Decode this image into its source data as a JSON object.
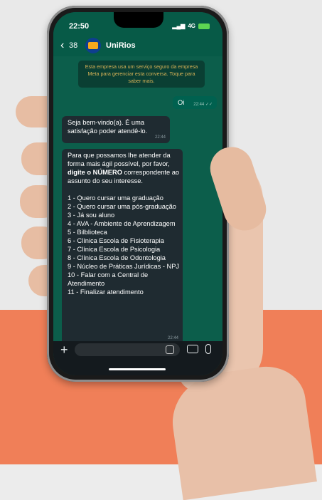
{
  "statusbar": {
    "time": "22:50",
    "network": "4G"
  },
  "header": {
    "back_count": "38",
    "contact_name": "UniRios"
  },
  "chat": {
    "system_notice": "Esta empresa usa um serviço seguro da empresa Meta para gerenciar esta conversa. Toque para saber mais.",
    "messages": [
      {
        "direction": "out",
        "text": "Oi",
        "time": "22:44"
      },
      {
        "direction": "in",
        "text": "Seja bem-vindo(a). É uma satisfação poder atendê-lo.",
        "time": "22:44"
      },
      {
        "direction": "in",
        "intro_pre": "Para que possamos lhe atender da forma mais ágil possível, por favor, ",
        "intro_bold": "digite o NÚMERO",
        "intro_post": " correspondente ao assunto do seu interesse.",
        "options": [
          "1 - Quero cursar uma graduação",
          "2 - Quero cursar uma pós-graduação",
          "3 - Já sou aluno",
          "4 - AVA - Ambiente de Aprendizagem",
          "5 - Bilblioteca",
          "6 - Clínica Escola de Fisioterapia",
          "7 - Clínica Escola de Psicologia",
          "8 - Clínica Escola de Odontologia",
          "9 - Núcleo de Práticas Jurídicas - NPJ",
          "10 - Falar com a Central de Atendimento",
          "11 - Finalizar atendimento"
        ],
        "time": "22:44"
      }
    ]
  },
  "colors": {
    "header_bg": "#075a47",
    "chat_bg": "#0c5e4b",
    "incoming_bubble": "#1f2b31",
    "outgoing_bubble": "#00614f",
    "page_orange": "#f07f58"
  }
}
